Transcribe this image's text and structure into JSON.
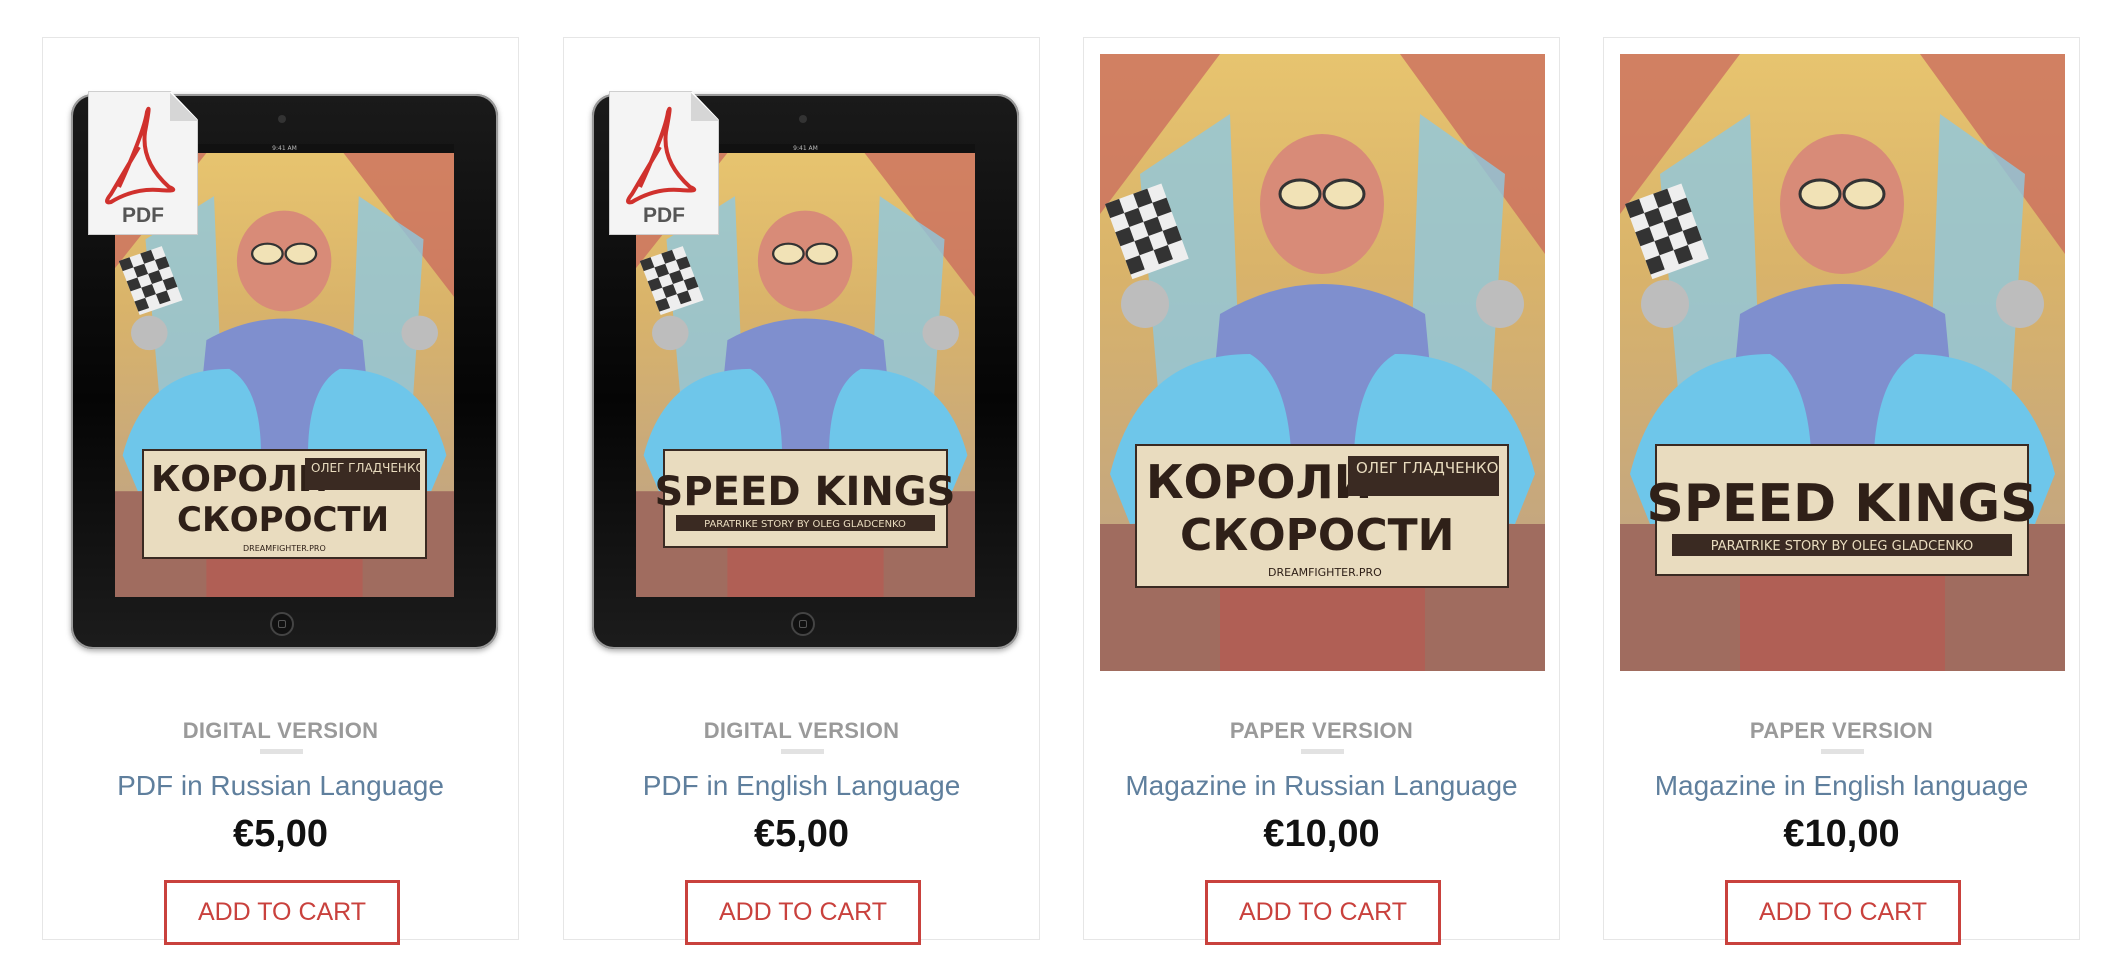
{
  "colors": {
    "category": "#9a9a9a",
    "product_name": "#5f7f9d",
    "price": "#111111",
    "button": "#c9413d",
    "card_border": "#e6e6e6"
  },
  "tablet_status": "9:41 AM",
  "products": [
    {
      "category": "DIGITAL VERSION",
      "name": "PDF in Russian Language",
      "price": "€5,00",
      "button": "ADD TO CART",
      "badge": "PDF",
      "cover_title_1": "КОРОЛИ",
      "cover_title_2": "СКОРОСТИ",
      "cover_author": "ОЛЕГ ГЛАДЧЕНКО",
      "cover_site": "DREAMFIGHTER.PRO"
    },
    {
      "category": "DIGITAL VERSION",
      "name": "PDF in English Language",
      "price": "€5,00",
      "button": "ADD TO CART",
      "badge": "PDF",
      "cover_title_1": "SPEED KINGS",
      "cover_subtitle": "PARATRIKE STORY BY OLEG GLADCENKO"
    },
    {
      "category": "PAPER VERSION",
      "name": "Magazine in Russian Language",
      "price": "€10,00",
      "button": "ADD TO CART",
      "cover_title_1": "КОРОЛИ",
      "cover_title_2": "СКОРОСТИ",
      "cover_author": "ОЛЕГ ГЛАДЧЕНКО",
      "cover_site": "DREAMFIGHTER.PRO"
    },
    {
      "category": "PAPER VERSION",
      "name": "Magazine in English language",
      "price": "€10,00",
      "button": "ADD TO CART",
      "cover_title_1": "SPEED KINGS",
      "cover_subtitle": "PARATRIKE STORY BY OLEG GLADCENKO"
    }
  ]
}
